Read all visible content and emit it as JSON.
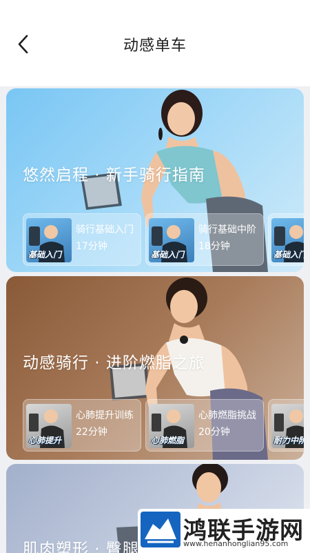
{
  "header": {
    "title": "动感单车",
    "back_icon": "chevron-left-icon"
  },
  "cards": [
    {
      "title": "悠然启程 · 新手骑行指南",
      "bg_from": "#8ccff5",
      "bg_to": "#bfe3f8",
      "lessons": [
        {
          "thumb_text": "基础入门",
          "name": "骑行基础入门",
          "duration": "17分钟"
        },
        {
          "thumb_text": "基础入门",
          "name": "骑行基础中阶",
          "duration": "18分钟"
        },
        {
          "thumb_text": "基础入门",
          "name": "",
          "duration": ""
        }
      ]
    },
    {
      "title": "动感骑行 · 进阶燃脂之旅",
      "bg_from": "#9b6a45",
      "bg_to": "#c8a98f",
      "lessons": [
        {
          "thumb_text": "心肺提升",
          "name": "心肺提升训练",
          "duration": "22分钟"
        },
        {
          "thumb_text": "心肺燃脂",
          "name": "心肺燃脂挑战",
          "duration": "20分钟"
        },
        {
          "thumb_text": "耐力中阶",
          "name": "",
          "duration": ""
        }
      ]
    },
    {
      "title": "肌肉塑形 · 臀腿",
      "bg_from": "#aeb9d0",
      "bg_to": "#d6dceb",
      "lessons": []
    }
  ],
  "watermark": {
    "text": "鸿联手游网",
    "url": "www.henanhonglian95.com"
  }
}
